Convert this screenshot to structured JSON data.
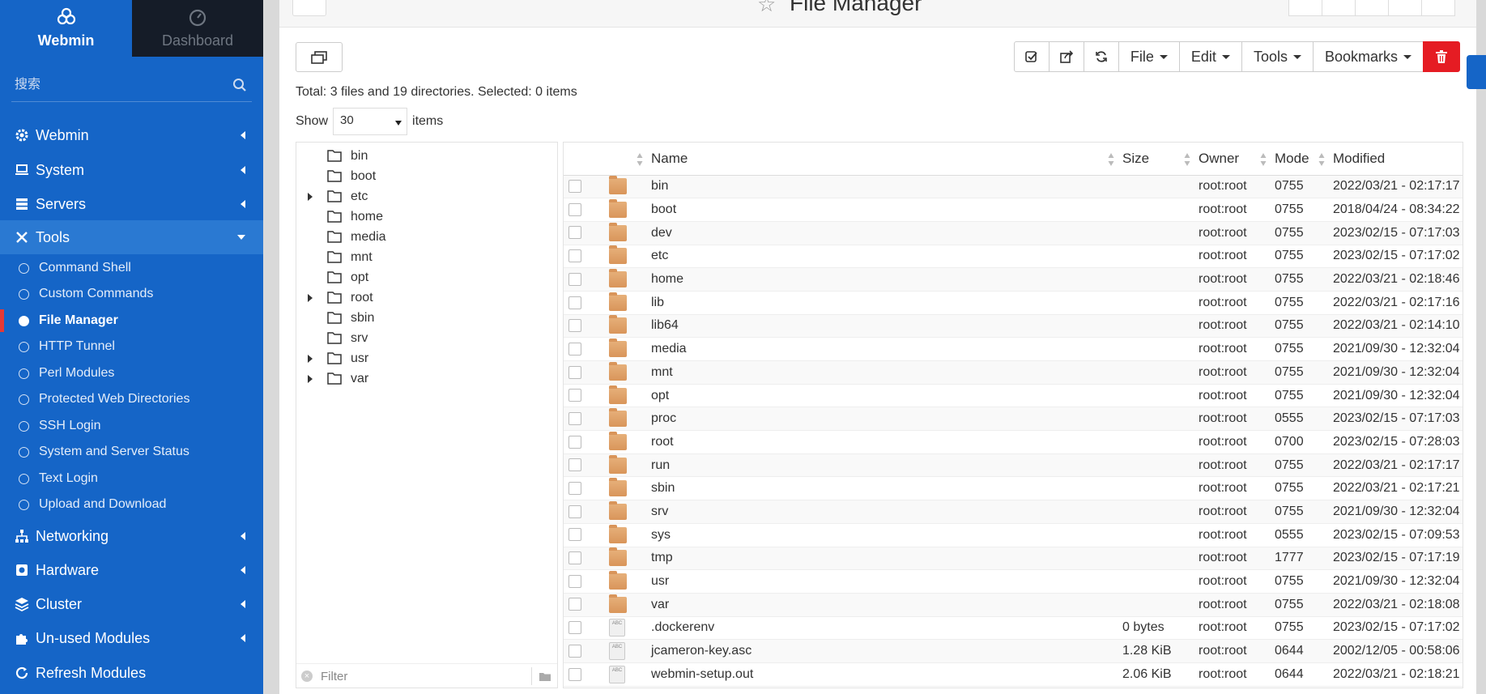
{
  "brand": {
    "title": "Webmin",
    "dashboard": "Dashboard"
  },
  "search": {
    "placeholder": "搜索"
  },
  "menu": [
    {
      "label": "Webmin",
      "icon": "gear-icon",
      "open": false
    },
    {
      "label": "System",
      "icon": "laptop-icon",
      "open": false
    },
    {
      "label": "Servers",
      "icon": "server-icon",
      "open": false
    },
    {
      "label": "Tools",
      "icon": "tools-icon",
      "open": true
    }
  ],
  "tools_submenu": [
    "Command Shell",
    "Custom Commands",
    "File Manager",
    "HTTP Tunnel",
    "Perl Modules",
    "Protected Web Directories",
    "SSH Login",
    "System and Server Status",
    "Text Login",
    "Upload and Download"
  ],
  "active_submenu": "File Manager",
  "menu_bottom": [
    {
      "label": "Networking",
      "icon": "network-icon"
    },
    {
      "label": "Hardware",
      "icon": "hardware-icon"
    },
    {
      "label": "Cluster",
      "icon": "cluster-icon"
    },
    {
      "label": "Un-used Modules",
      "icon": "puzzle-icon"
    },
    {
      "label": "Refresh Modules",
      "icon": "refresh-icon"
    }
  ],
  "page": {
    "title": "File Manager"
  },
  "toolbar": {
    "file": "File",
    "edit": "Edit",
    "tools": "Tools",
    "bookmarks": "Bookmarks"
  },
  "summary": "Total: 3 files and 19 directories. Selected: 0 items",
  "show": {
    "prefix": "Show",
    "value": "30",
    "suffix": "items"
  },
  "tree": [
    {
      "name": "bin",
      "expandable": false
    },
    {
      "name": "boot",
      "expandable": false
    },
    {
      "name": "etc",
      "expandable": true
    },
    {
      "name": "home",
      "expandable": false
    },
    {
      "name": "media",
      "expandable": false
    },
    {
      "name": "mnt",
      "expandable": false
    },
    {
      "name": "opt",
      "expandable": false
    },
    {
      "name": "root",
      "expandable": true
    },
    {
      "name": "sbin",
      "expandable": false
    },
    {
      "name": "srv",
      "expandable": false
    },
    {
      "name": "usr",
      "expandable": true
    },
    {
      "name": "var",
      "expandable": true
    }
  ],
  "filter": {
    "placeholder": "Filter"
  },
  "columns": {
    "name": "Name",
    "size": "Size",
    "owner": "Owner",
    "mode": "Mode",
    "modified": "Modified"
  },
  "files": [
    {
      "name": "bin",
      "type": "dir",
      "size": "",
      "owner": "root:root",
      "mode": "0755",
      "modified": "2022/03/21 - 02:17:17"
    },
    {
      "name": "boot",
      "type": "dir",
      "size": "",
      "owner": "root:root",
      "mode": "0755",
      "modified": "2018/04/24 - 08:34:22"
    },
    {
      "name": "dev",
      "type": "dir",
      "size": "",
      "owner": "root:root",
      "mode": "0755",
      "modified": "2023/02/15 - 07:17:03"
    },
    {
      "name": "etc",
      "type": "dir",
      "size": "",
      "owner": "root:root",
      "mode": "0755",
      "modified": "2023/02/15 - 07:17:02"
    },
    {
      "name": "home",
      "type": "dir",
      "size": "",
      "owner": "root:root",
      "mode": "0755",
      "modified": "2022/03/21 - 02:18:46"
    },
    {
      "name": "lib",
      "type": "dir",
      "size": "",
      "owner": "root:root",
      "mode": "0755",
      "modified": "2022/03/21 - 02:17:16"
    },
    {
      "name": "lib64",
      "type": "dir",
      "size": "",
      "owner": "root:root",
      "mode": "0755",
      "modified": "2022/03/21 - 02:14:10"
    },
    {
      "name": "media",
      "type": "dir",
      "size": "",
      "owner": "root:root",
      "mode": "0755",
      "modified": "2021/09/30 - 12:32:04"
    },
    {
      "name": "mnt",
      "type": "dir",
      "size": "",
      "owner": "root:root",
      "mode": "0755",
      "modified": "2021/09/30 - 12:32:04"
    },
    {
      "name": "opt",
      "type": "dir",
      "size": "",
      "owner": "root:root",
      "mode": "0755",
      "modified": "2021/09/30 - 12:32:04"
    },
    {
      "name": "proc",
      "type": "dir",
      "size": "",
      "owner": "root:root",
      "mode": "0555",
      "modified": "2023/02/15 - 07:17:03"
    },
    {
      "name": "root",
      "type": "dir",
      "size": "",
      "owner": "root:root",
      "mode": "0700",
      "modified": "2023/02/15 - 07:28:03"
    },
    {
      "name": "run",
      "type": "dir",
      "size": "",
      "owner": "root:root",
      "mode": "0755",
      "modified": "2022/03/21 - 02:17:17"
    },
    {
      "name": "sbin",
      "type": "dir",
      "size": "",
      "owner": "root:root",
      "mode": "0755",
      "modified": "2022/03/21 - 02:17:21"
    },
    {
      "name": "srv",
      "type": "dir",
      "size": "",
      "owner": "root:root",
      "mode": "0755",
      "modified": "2021/09/30 - 12:32:04"
    },
    {
      "name": "sys",
      "type": "dir",
      "size": "",
      "owner": "root:root",
      "mode": "0555",
      "modified": "2023/02/15 - 07:09:53"
    },
    {
      "name": "tmp",
      "type": "dir",
      "size": "",
      "owner": "root:root",
      "mode": "1777",
      "modified": "2023/02/15 - 07:17:19"
    },
    {
      "name": "usr",
      "type": "dir",
      "size": "",
      "owner": "root:root",
      "mode": "0755",
      "modified": "2021/09/30 - 12:32:04"
    },
    {
      "name": "var",
      "type": "dir",
      "size": "",
      "owner": "root:root",
      "mode": "0755",
      "modified": "2022/03/21 - 02:18:08"
    },
    {
      "name": ".dockerenv",
      "type": "file",
      "size": "0 bytes",
      "owner": "root:root",
      "mode": "0755",
      "modified": "2023/02/15 - 07:17:02"
    },
    {
      "name": "jcameron-key.asc",
      "type": "file",
      "size": "1.28 KiB",
      "owner": "root:root",
      "mode": "0644",
      "modified": "2002/12/05 - 00:58:06"
    },
    {
      "name": "webmin-setup.out",
      "type": "file",
      "size": "2.06 KiB",
      "owner": "root:root",
      "mode": "0644",
      "modified": "2022/03/21 - 02:18:21"
    }
  ],
  "colors": {
    "sidebar": "#1565c7",
    "active_marker": "#e53935",
    "delete_button": "#e51c23",
    "dashboard_tab": "#151c28"
  }
}
